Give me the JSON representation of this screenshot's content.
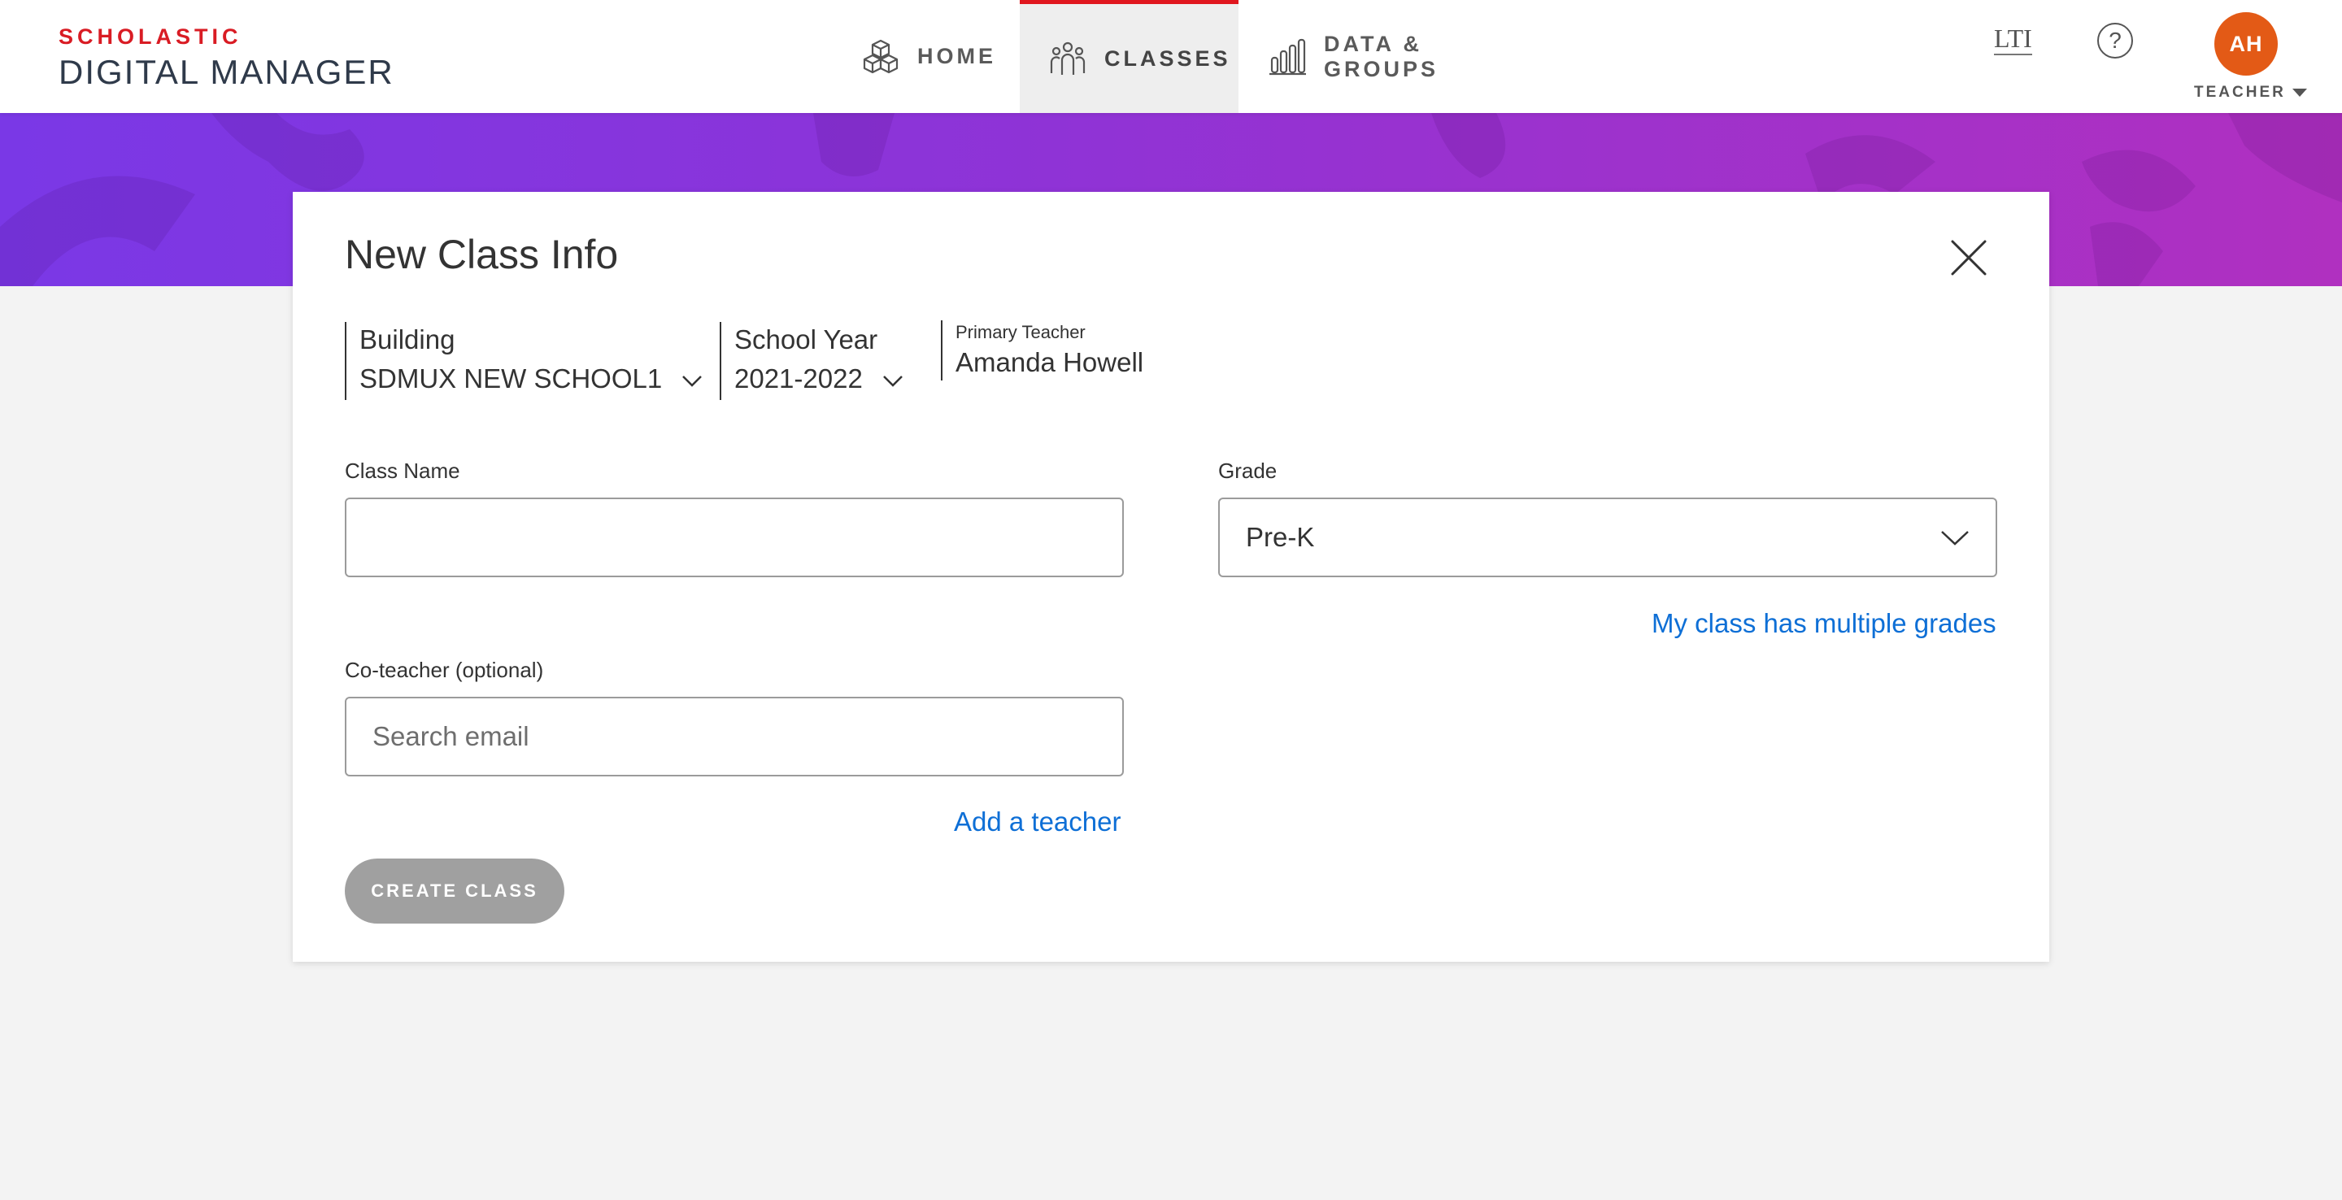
{
  "brand": {
    "top": "SCHOLASTIC",
    "bottom": "DIGITAL MANAGER"
  },
  "nav": {
    "home": "HOME",
    "classes": "CLASSES",
    "data_groups": "DATA & GROUPS"
  },
  "header": {
    "lti": "LTI",
    "help": "?",
    "avatar_initials": "AH",
    "role": "TEACHER"
  },
  "modal": {
    "title": "New Class Info",
    "building_label": "Building",
    "building_value": "SDMUX NEW SCHOOL1",
    "school_year_label": "School Year",
    "school_year_value": "2021-2022",
    "primary_teacher_label": "Primary Teacher",
    "primary_teacher_value": "Amanda Howell",
    "class_name_label": "Class Name",
    "class_name_value": "",
    "grade_label": "Grade",
    "grade_value": "Pre-K",
    "multiple_grades_link": "My class has multiple grades",
    "coteacher_label": "Co-teacher (optional)",
    "coteacher_placeholder": "Search email",
    "add_teacher_link": "Add a teacher",
    "create_button": "CREATE CLASS"
  },
  "colors": {
    "accent": "#e0161e",
    "brand_red": "#d91c24",
    "link": "#0e6fd6",
    "avatar": "#e35a16",
    "banner_start": "#7a38e6",
    "banner_end": "#b030c0",
    "disabled_button": "#a0a0a0"
  }
}
